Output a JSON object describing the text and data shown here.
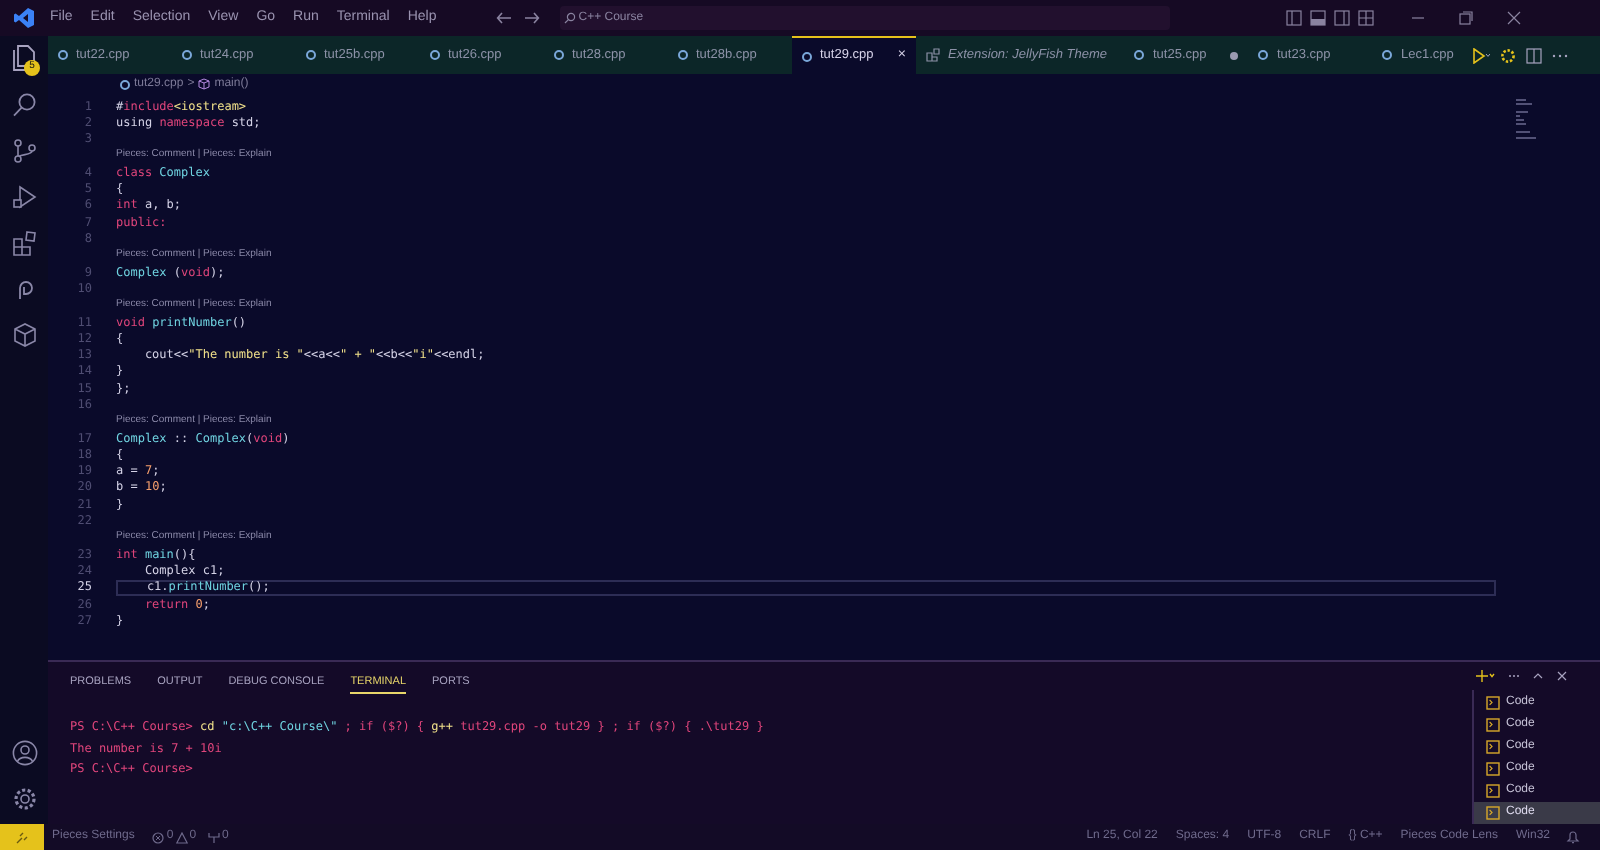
{
  "menu": [
    "File",
    "Edit",
    "Selection",
    "View",
    "Go",
    "Run",
    "Terminal",
    "Help"
  ],
  "search": {
    "value": "C++ Course"
  },
  "explorer_badge": "5",
  "tabs": [
    {
      "label": "tut22.cpp",
      "kind": "cpp",
      "selected": false,
      "dirty": false
    },
    {
      "label": "tut24.cpp",
      "kind": "cpp",
      "selected": false,
      "dirty": false
    },
    {
      "label": "tut25b.cpp",
      "kind": "cpp",
      "selected": false,
      "dirty": false
    },
    {
      "label": "tut26.cpp",
      "kind": "cpp",
      "selected": false,
      "dirty": false
    },
    {
      "label": "tut28.cpp",
      "kind": "cpp",
      "selected": false,
      "dirty": false
    },
    {
      "label": "tut28b.cpp",
      "kind": "cpp",
      "selected": false,
      "dirty": false
    },
    {
      "label": "tut29.cpp",
      "kind": "cpp",
      "selected": true,
      "dirty": false,
      "close": "×"
    },
    {
      "label": "Extension: JellyFish Theme",
      "kind": "extension",
      "selected": false,
      "dirty": false
    },
    {
      "label": "tut25.cpp",
      "kind": "cpp",
      "selected": false,
      "dirty": true
    },
    {
      "label": "tut23.cpp",
      "kind": "cpp",
      "selected": false,
      "dirty": false
    },
    {
      "label": "Lec1.cpp",
      "kind": "cpp",
      "selected": false,
      "dirty": false
    }
  ],
  "breadcrumb": {
    "file": "tut29.cpp",
    "separator": ">",
    "symbol": "main()"
  },
  "code_lines": [
    {
      "number": "1",
      "tokens": [
        {
          "text": "#",
          "kind": "plain"
        },
        {
          "text": "include",
          "kind": "keyword"
        },
        {
          "text": "<iostream>",
          "kind": "string"
        }
      ]
    },
    {
      "number": "2",
      "tokens": [
        {
          "text": "using ",
          "kind": "plain"
        },
        {
          "text": "namespace",
          "kind": "keyword"
        },
        {
          "text": " std;",
          "kind": "plain"
        }
      ]
    },
    {
      "number": "3"
    },
    {
      "number": "4",
      "codelens": "Pieces: Comment | Pieces: Explain",
      "tokens": [
        {
          "text": "class",
          "kind": "keyword"
        },
        {
          "text": " Complex",
          "kind": "type"
        }
      ]
    },
    {
      "number": "5",
      "tokens": [
        {
          "text": "{",
          "kind": "plain"
        }
      ]
    },
    {
      "number": "6",
      "tokens": [
        {
          "text": "int",
          "kind": "keyword"
        },
        {
          "text": " a, b;",
          "kind": "plain"
        }
      ]
    },
    {
      "number": "7",
      "tokens": [
        {
          "text": "public:",
          "kind": "keyword"
        }
      ]
    },
    {
      "number": "8"
    },
    {
      "number": "9",
      "codelens": "Pieces: Comment | Pieces: Explain",
      "tokens": [
        {
          "text": "Complex",
          "kind": "type"
        },
        {
          "text": " (",
          "kind": "plain"
        },
        {
          "text": "void",
          "kind": "keyword"
        },
        {
          "text": ");",
          "kind": "plain"
        }
      ]
    },
    {
      "number": "10"
    },
    {
      "number": "11",
      "codelens": "Pieces: Comment | Pieces: Explain",
      "tokens": [
        {
          "text": "void",
          "kind": "keyword"
        },
        {
          "text": " printNumber",
          "kind": "type"
        },
        {
          "text": "()",
          "kind": "plain"
        }
      ]
    },
    {
      "number": "12",
      "tokens": [
        {
          "text": "{",
          "kind": "plain"
        }
      ]
    },
    {
      "number": "13",
      "tokens": [
        {
          "text": "    cout<<",
          "kind": "plain"
        },
        {
          "text": "\"The number is \"",
          "kind": "string"
        },
        {
          "text": "<<a<<",
          "kind": "plain"
        },
        {
          "text": "\" + \"",
          "kind": "string"
        },
        {
          "text": "<<b<<",
          "kind": "plain"
        },
        {
          "text": "\"i\"",
          "kind": "string"
        },
        {
          "text": "<<endl;",
          "kind": "plain"
        }
      ]
    },
    {
      "number": "14",
      "tokens": [
        {
          "text": "}",
          "kind": "plain"
        }
      ]
    },
    {
      "number": "15",
      "tokens": [
        {
          "text": "};",
          "kind": "plain"
        }
      ]
    },
    {
      "number": "16"
    },
    {
      "number": "17",
      "codelens": "Pieces: Comment | Pieces: Explain",
      "tokens": [
        {
          "text": "Complex",
          "kind": "type"
        },
        {
          "text": " :: ",
          "kind": "plain"
        },
        {
          "text": "Complex",
          "kind": "type"
        },
        {
          "text": "(",
          "kind": "plain"
        },
        {
          "text": "void",
          "kind": "keyword"
        },
        {
          "text": ")",
          "kind": "plain"
        }
      ]
    },
    {
      "number": "18",
      "tokens": [
        {
          "text": "{",
          "kind": "plain"
        }
      ]
    },
    {
      "number": "19",
      "tokens": [
        {
          "text": "a = ",
          "kind": "plain"
        },
        {
          "text": "7",
          "kind": "number"
        },
        {
          "text": ";",
          "kind": "plain"
        }
      ]
    },
    {
      "number": "20",
      "tokens": [
        {
          "text": "b = ",
          "kind": "plain"
        },
        {
          "text": "10",
          "kind": "number"
        },
        {
          "text": ";",
          "kind": "plain"
        }
      ]
    },
    {
      "number": "21",
      "tokens": [
        {
          "text": "}",
          "kind": "plain"
        }
      ]
    },
    {
      "number": "22"
    },
    {
      "number": "23",
      "codelens": "Pieces: Comment | Pieces: Explain",
      "tokens": [
        {
          "text": "int",
          "kind": "keyword"
        },
        {
          "text": " main",
          "kind": "type"
        },
        {
          "text": "(){",
          "kind": "plain"
        }
      ]
    },
    {
      "number": "24",
      "tokens": [
        {
          "text": "    Complex c1;",
          "kind": "plain"
        }
      ]
    },
    {
      "number": "25",
      "current": true,
      "tokens": [
        {
          "text": "    c1.",
          "kind": "plain"
        },
        {
          "text": "printNumber",
          "kind": "type"
        },
        {
          "text": "();",
          "kind": "plain"
        }
      ]
    },
    {
      "number": "26",
      "tokens": [
        {
          "text": "    return",
          "kind": "keyword"
        },
        {
          "text": " 0",
          "kind": "number"
        },
        {
          "text": ";",
          "kind": "plain"
        }
      ]
    },
    {
      "number": "27",
      "tokens": [
        {
          "text": "}",
          "kind": "plain"
        }
      ]
    }
  ],
  "panel_tabs": [
    {
      "label": "PROBLEMS",
      "selected": false
    },
    {
      "label": "OUTPUT",
      "selected": false
    },
    {
      "label": "DEBUG CONSOLE",
      "selected": false
    },
    {
      "label": "TERMINAL",
      "selected": true
    },
    {
      "label": "PORTS",
      "selected": false
    }
  ],
  "terminal_lines": [
    [
      {
        "text": "PS C:\\C++ Course> ",
        "kind": "plain"
      },
      {
        "text": "cd",
        "kind": "command"
      },
      {
        "text": " \"c:\\C++ Course\\\"",
        "kind": "arg"
      },
      {
        "text": " ; if ($?) { ",
        "kind": "plain"
      },
      {
        "text": "g++",
        "kind": "command"
      },
      {
        "text": " tut29.cpp -o tut29 } ; if ($?) { .\\tut29 }",
        "kind": "plain"
      }
    ],
    [
      {
        "text": "The number is 7 + 10i",
        "kind": "output"
      }
    ],
    [
      {
        "text": "PS C:\\C++ Course>",
        "kind": "plain"
      }
    ]
  ],
  "terminals": [
    {
      "label": "Code",
      "selected": false
    },
    {
      "label": "Code",
      "selected": false
    },
    {
      "label": "Code",
      "selected": false
    },
    {
      "label": "Code",
      "selected": false
    },
    {
      "label": "Code",
      "selected": false
    },
    {
      "label": "Code",
      "selected": true
    }
  ],
  "status_left": {
    "pieces": "Pieces Settings",
    "errors": "0",
    "warnings": "0",
    "ports": "0"
  },
  "status_right": [
    "Ln 25, Col 22",
    "Spaces: 4",
    "UTF-8",
    "CRLF",
    "{} C++",
    "Pieces Code Lens",
    "Win32"
  ]
}
